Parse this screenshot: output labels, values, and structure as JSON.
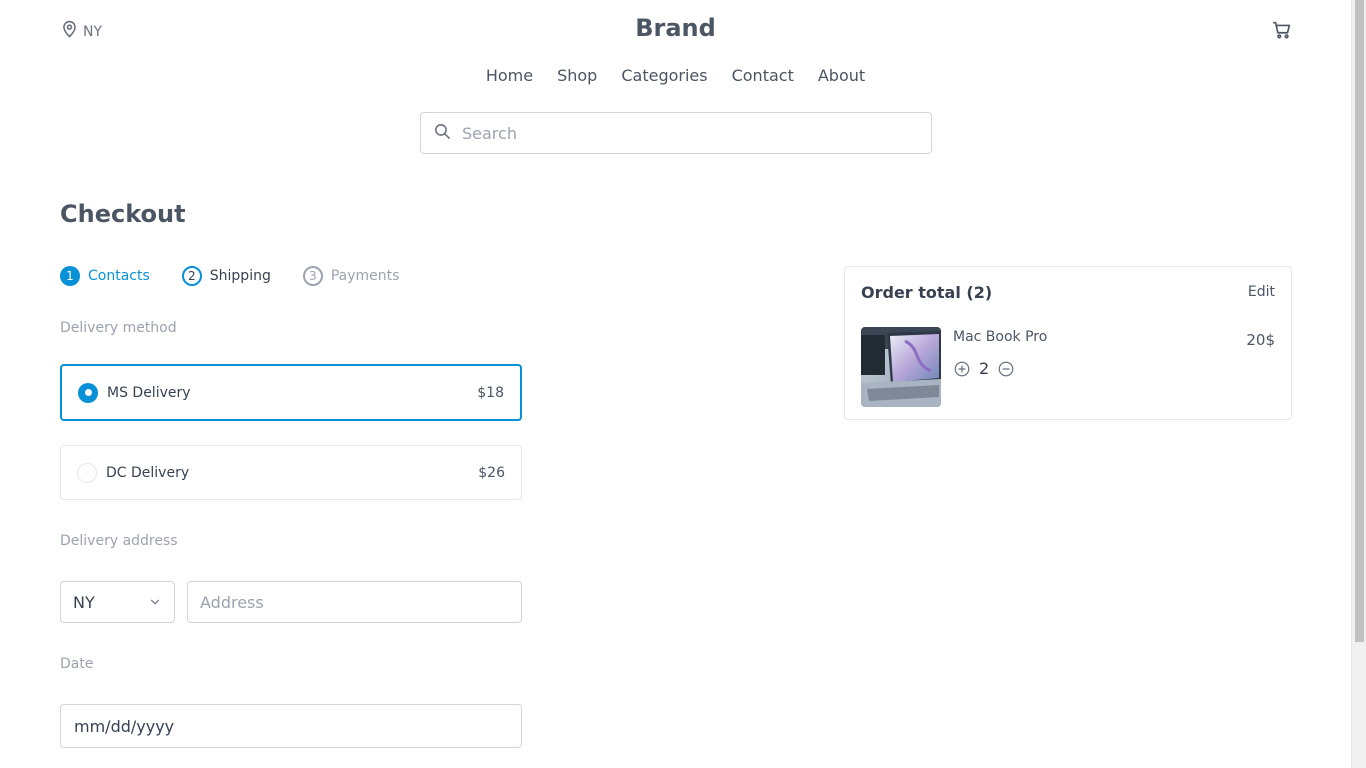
{
  "header": {
    "location": "NY",
    "brand": "Brand"
  },
  "nav": [
    "Home",
    "Shop",
    "Categories",
    "Contact",
    "About"
  ],
  "search": {
    "placeholder": "Search"
  },
  "page_title": "Checkout",
  "steps": [
    {
      "num": "1",
      "label": "Contacts"
    },
    {
      "num": "2",
      "label": "Shipping"
    },
    {
      "num": "3",
      "label": "Payments"
    }
  ],
  "delivery": {
    "label": "Delivery method",
    "options": [
      {
        "name": "MS Delivery",
        "price": "$18",
        "selected": true
      },
      {
        "name": "DC Delivery",
        "price": "$26",
        "selected": false
      }
    ]
  },
  "address": {
    "label": "Delivery address",
    "state": "NY",
    "placeholder": "Address"
  },
  "date": {
    "label": "Date",
    "placeholder": "mm/dd/yyyy"
  },
  "order": {
    "title": "Order total (2)",
    "edit": "Edit",
    "item": {
      "name": "Mac Book Pro",
      "quantity": "2",
      "price": "20$"
    }
  },
  "colors": {
    "accent": "#0891d6",
    "text": "#374151",
    "muted": "#9ca3af"
  }
}
